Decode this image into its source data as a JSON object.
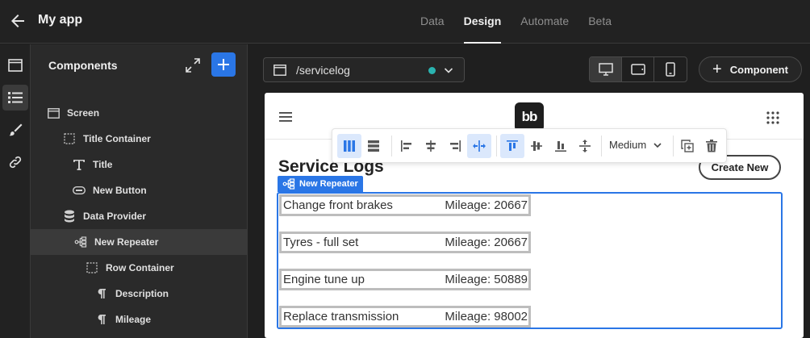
{
  "app": {
    "title": "My app"
  },
  "tabs": [
    {
      "label": "Data",
      "active": false
    },
    {
      "label": "Design",
      "active": true
    },
    {
      "label": "Automate",
      "active": false
    },
    {
      "label": "Beta",
      "active": false
    }
  ],
  "panel": {
    "title": "Components",
    "tree": [
      {
        "label": "Screen",
        "icon": "screen-icon"
      },
      {
        "label": "Title Container",
        "icon": "container-icon"
      },
      {
        "label": "Title",
        "icon": "text-icon"
      },
      {
        "label": "New Button",
        "icon": "button-icon"
      },
      {
        "label": "Data Provider",
        "icon": "database-icon"
      },
      {
        "label": "New Repeater",
        "icon": "repeater-icon",
        "selected": true
      },
      {
        "label": "Row Container",
        "icon": "container-icon"
      },
      {
        "label": "Description",
        "icon": "paragraph-icon"
      },
      {
        "label": "Mileage",
        "icon": "paragraph-icon"
      }
    ]
  },
  "canvas": {
    "route": "/servicelog",
    "add_component_label": "Component",
    "size_option": "Medium"
  },
  "preview": {
    "logo_text": "bb",
    "heading": "Service Logs",
    "create_button": "Create New",
    "repeater_tag": "New Repeater",
    "rows": [
      {
        "description": "Change front brakes",
        "mileage": "Mileage: 20667"
      },
      {
        "description": "Tyres - full set",
        "mileage": "Mileage: 20667"
      },
      {
        "description": "Engine tune up",
        "mileage": "Mileage: 50889"
      },
      {
        "description": "Replace transmission",
        "mileage": "Mileage: 98002"
      }
    ]
  },
  "colors": {
    "accent": "#2a76e6",
    "status_dot": "#2ab3b0"
  }
}
